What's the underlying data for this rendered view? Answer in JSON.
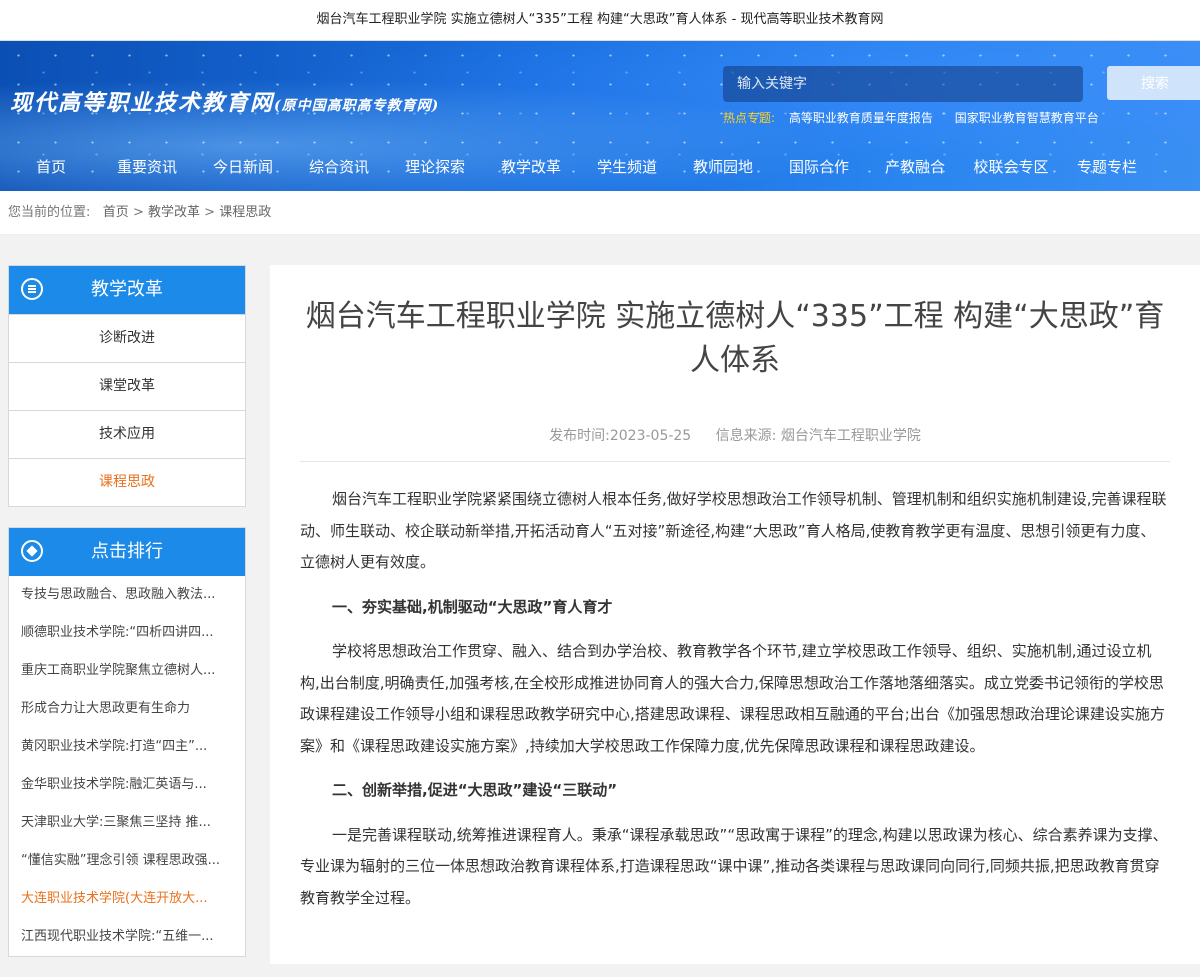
{
  "page": {
    "window_title": "烟台汽车工程职业学院 实施立德树人“335”工程 构建“大思政”育人体系 - 现代高等职业技术教育网"
  },
  "header": {
    "logo_main": "现代高等职业技术教育网",
    "logo_sub": "(原中国高职高专教育网)",
    "search_placeholder": "输入关键字",
    "search_button": "搜索",
    "hot_label": "热点专题:",
    "hot_links": [
      "高等职业教育质量年度报告",
      "国家职业教育智慧教育平台"
    ]
  },
  "nav": [
    "首页",
    "重要资讯",
    "今日新闻",
    "综合资讯",
    "理论探索",
    "教学改革",
    "学生频道",
    "教师园地",
    "国际合作",
    "产教融合",
    "校联会专区",
    "专题专栏"
  ],
  "breadcrumb": {
    "prefix": "您当前的位置:",
    "items": [
      "首页",
      "教学改革",
      "课程思政"
    ],
    "sep": ">"
  },
  "sidebar": {
    "section_title": "教学改革",
    "items": [
      "诊断改进",
      "课堂改革",
      "技术应用",
      "课程思政"
    ],
    "active_index": 3,
    "rank_title": "点击排行",
    "rank_items": [
      "专技与思政融合、思政融入教法...",
      "顺德职业技术学院:“四析四讲四...",
      "重庆工商职业学院聚焦立德树人...",
      "形成合力让大思政更有生命力",
      "黄冈职业技术学院:打造“四主”...",
      "金华职业技术学院:融汇英语与...",
      "天津职业大学:三聚焦三坚持 推...",
      "“懂信实融”理念引领 课程思政强...",
      "大连职业技术学院(大连开放大...",
      "江西现代职业技术学院:“五维一..."
    ],
    "rank_highlight_index": 8
  },
  "article": {
    "title": "烟台汽车工程职业学院 实施立德树人“335”工程 构建“大思政”育人体系",
    "publish_time": "发布时间:2023-05-25",
    "source": "信息来源: 烟台汽车工程职业学院",
    "paragraphs": [
      {
        "type": "p",
        "text": "烟台汽车工程职业学院紧紧围绕立德树人根本任务,做好学校思想政治工作领导机制、管理机制和组织实施机制建设,完善课程联动、师生联动、校企联动新举措,开拓活动育人“五对接”新途径,构建“大思政”育人格局,使教育教学更有温度、思想引领更有力度、立德树人更有效度。"
      },
      {
        "type": "h",
        "text": "一、夯实基础,机制驱动“大思政”育人育才"
      },
      {
        "type": "p",
        "text": "学校将思想政治工作贯穿、融入、结合到办学治校、教育教学各个环节,建立学校思政工作领导、组织、实施机制,通过设立机构,出台制度,明确责任,加强考核,在全校形成推进协同育人的强大合力,保障思想政治工作落地落细落实。成立党委书记领衔的学校思政课程建设工作领导小组和课程思政教学研究中心,搭建思政课程、课程思政相互融通的平台;出台《加强思想政治理论课建设实施方案》和《课程思政建设实施方案》,持续加大学校思政工作保障力度,优先保障思政课程和课程思政建设。"
      },
      {
        "type": "h",
        "text": "二、创新举措,促进“大思政”建设“三联动”"
      },
      {
        "type": "p",
        "text": "一是完善课程联动,统筹推进课程育人。秉承“课程承载思政”“思政寓于课程”的理念,构建以思政课为核心、综合素养课为支撑、专业课为辐射的三位一体思想政治教育课程体系,打造课程思政“课中课”,推动各类课程与思政课同向同行,同频共振,把思政教育贯穿教育教学全过程。"
      }
    ]
  }
}
